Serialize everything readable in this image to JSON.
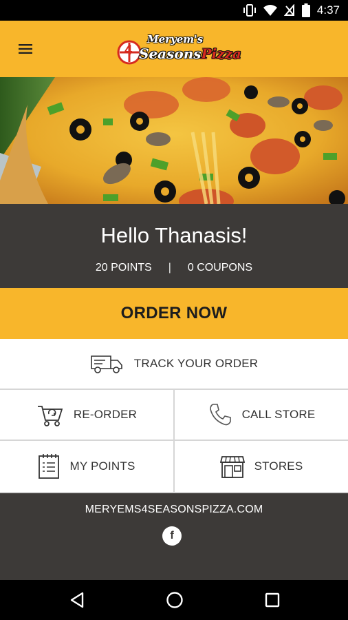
{
  "status_bar": {
    "time": "4:37",
    "icons": [
      "vibrate-icon",
      "wifi-icon",
      "no-sim-icon",
      "battery-icon"
    ]
  },
  "app_bar": {
    "menu_icon": "hamburger-menu-icon",
    "logo": {
      "line1": "Meryem's",
      "line2_a": "Seasons",
      "line2_b": "Pizza",
      "mark": "4"
    }
  },
  "hero": {
    "image_subject": "pizza-slice-photo"
  },
  "greeting": {
    "title": "Hello Thanasis!",
    "points": "20 POINTS",
    "separator": "|",
    "coupons": "0 COUPONS"
  },
  "order_now": {
    "label": "ORDER NOW"
  },
  "track_order": {
    "label": "TRACK YOUR ORDER",
    "icon": "delivery-truck-icon"
  },
  "tiles": [
    {
      "label": "RE-ORDER",
      "icon": "reorder-cart-icon"
    },
    {
      "label": "CALL STORE",
      "icon": "phone-icon"
    },
    {
      "label": "MY POINTS",
      "icon": "points-notepad-icon"
    },
    {
      "label": "STORES",
      "icon": "storefront-icon"
    }
  ],
  "footer": {
    "website": "MERYEMS4SEASONSPIZZA.COM",
    "social_icon": "facebook-icon",
    "facebook_glyph": "f"
  },
  "nav_bar": {
    "icons": [
      "back-icon",
      "home-icon",
      "recents-icon"
    ]
  },
  "colors": {
    "brand_yellow": "#f8b62b",
    "dark_panel": "#3d3a38",
    "tile_bg": "#ffffff",
    "divider": "#d6d6d6",
    "logo_red": "#d62a1f"
  }
}
